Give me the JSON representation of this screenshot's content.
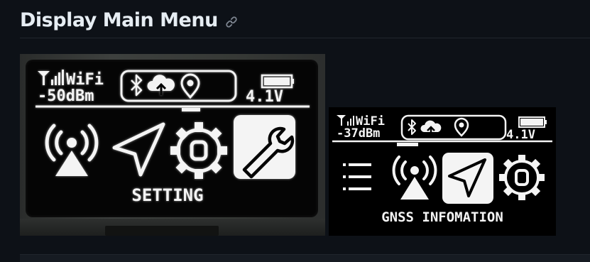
{
  "section": {
    "title": "Display Main Menu",
    "anchor_icon": "link-icon"
  },
  "photo_screen": {
    "wifi_label": "WiFi",
    "signal": "-50dBm",
    "battery_voltage": "4.1V",
    "status_icons": [
      "bluetooth-icon",
      "cloud-upload-icon",
      "location-pin-icon"
    ],
    "menu_icons": [
      "radio-tower-icon",
      "navigation-arrow-icon",
      "gear-icon",
      "wrench-icon"
    ],
    "selected_item": "wrench-icon",
    "menu_label": "SETTING"
  },
  "clean_screen": {
    "wifi_label": "WiFi",
    "signal": "-37dBm",
    "battery_voltage": "4.1V",
    "status_icons": [
      "bluetooth-icon",
      "cloud-upload-icon",
      "location-pin-icon"
    ],
    "menu_icons": [
      "list-icon",
      "radio-tower-icon",
      "navigation-arrow-icon",
      "gear-icon"
    ],
    "selected_item": "navigation-arrow-icon",
    "menu_label": "GNSS INFOMATION"
  },
  "colors": {
    "page_background": "#0d1117",
    "heading_text": "#e6edf3",
    "oled_pixel": "#f4f4f4",
    "oled_background": "#000000"
  }
}
